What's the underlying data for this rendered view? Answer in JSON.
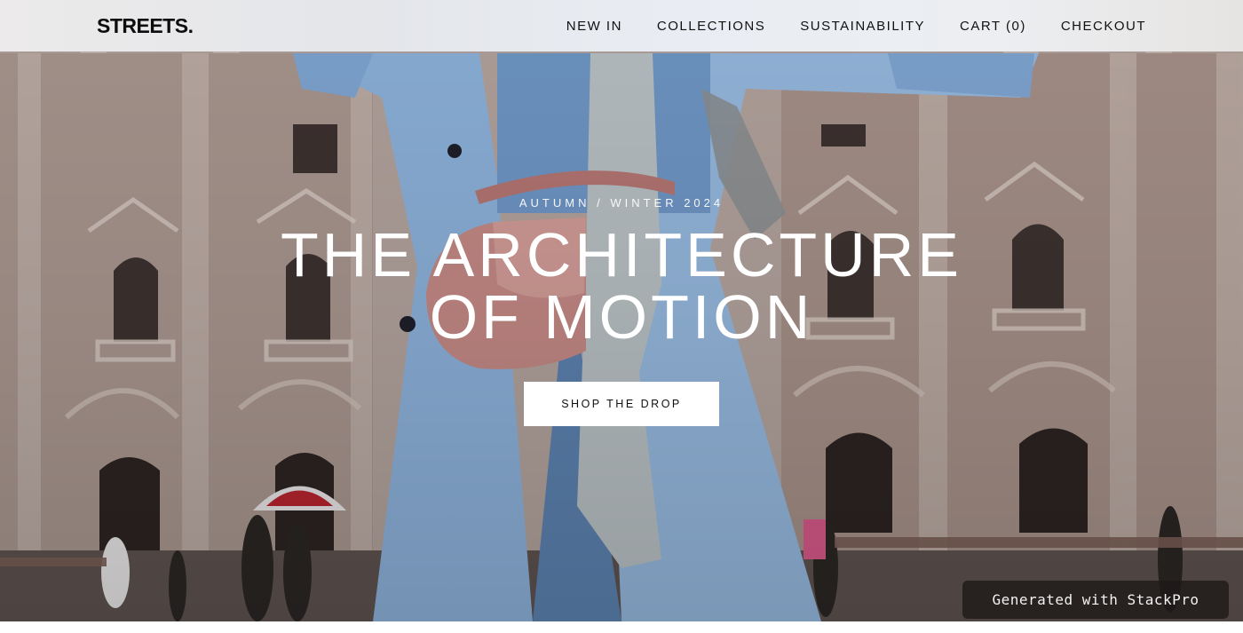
{
  "header": {
    "logo": "STREETS.",
    "nav": [
      {
        "label": "NEW IN"
      },
      {
        "label": "COLLECTIONS"
      },
      {
        "label": "SUSTAINABILITY"
      },
      {
        "label": "CART (0)"
      },
      {
        "label": "CHECKOUT"
      }
    ]
  },
  "hero": {
    "eyebrow": "AUTUMN / WINTER 2024",
    "headline_line1": "THE ARCHITECTURE",
    "headline_line2": "OF MOTION",
    "cta_label": "SHOP THE DROP"
  },
  "badge": {
    "label": "Generated with StackPro"
  },
  "colors": {
    "coat": "#8fb3dc",
    "bag": "#c98a86",
    "building": "#a8968f",
    "cta_bg": "#ffffff",
    "badge_bg": "#1e1a18"
  }
}
